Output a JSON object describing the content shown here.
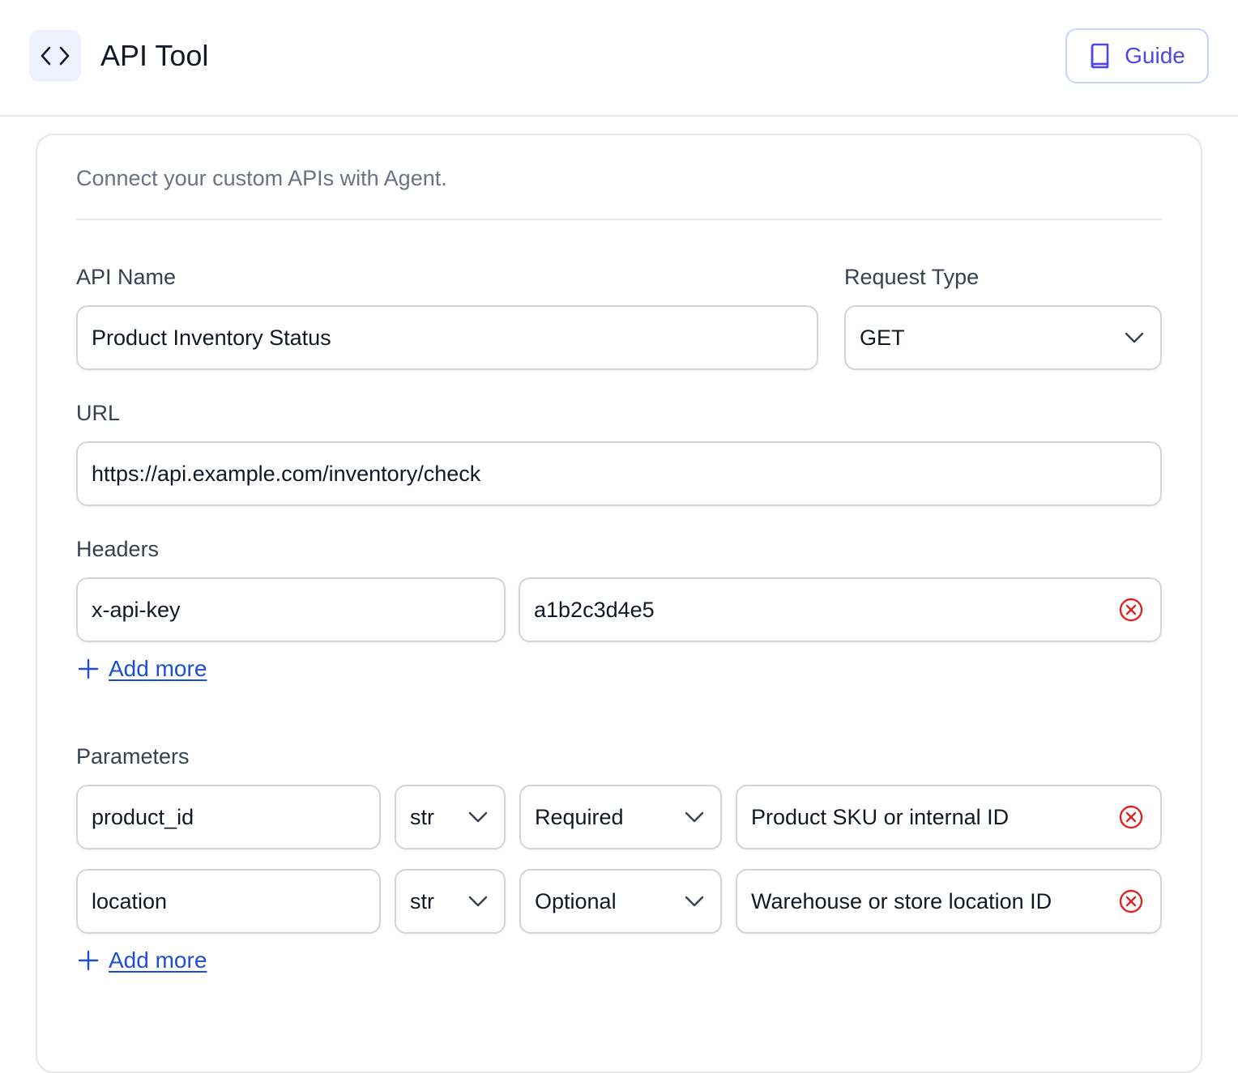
{
  "header": {
    "title": "API Tool",
    "guide_label": "Guide"
  },
  "card": {
    "description": "Connect your custom APIs with Agent."
  },
  "form": {
    "api_name": {
      "label": "API Name",
      "value": "Product Inventory Status"
    },
    "request_type": {
      "label": "Request Type",
      "value": "GET"
    },
    "url": {
      "label": "URL",
      "value": "https://api.example.com/inventory/check"
    },
    "headers": {
      "label": "Headers",
      "rows": [
        {
          "key": "x-api-key",
          "value": "a1b2c3d4e5"
        }
      ],
      "add_more_label": "Add more"
    },
    "parameters": {
      "label": "Parameters",
      "rows": [
        {
          "name": "product_id",
          "type": "str",
          "required": "Required",
          "description": "Product SKU or internal ID"
        },
        {
          "name": "location",
          "type": "str",
          "required": "Optional",
          "description": "Warehouse or store location ID"
        }
      ],
      "add_more_label": "Add more"
    }
  },
  "colors": {
    "accent": "#4f46e5",
    "link": "#1d4ed8",
    "remove": "#dc2626",
    "border": "#d1d5db"
  },
  "icons": {
    "app": "code-icon",
    "guide": "book-icon",
    "dropdown": "chevron-down-icon",
    "remove": "remove-circle-icon",
    "add": "plus-icon"
  }
}
